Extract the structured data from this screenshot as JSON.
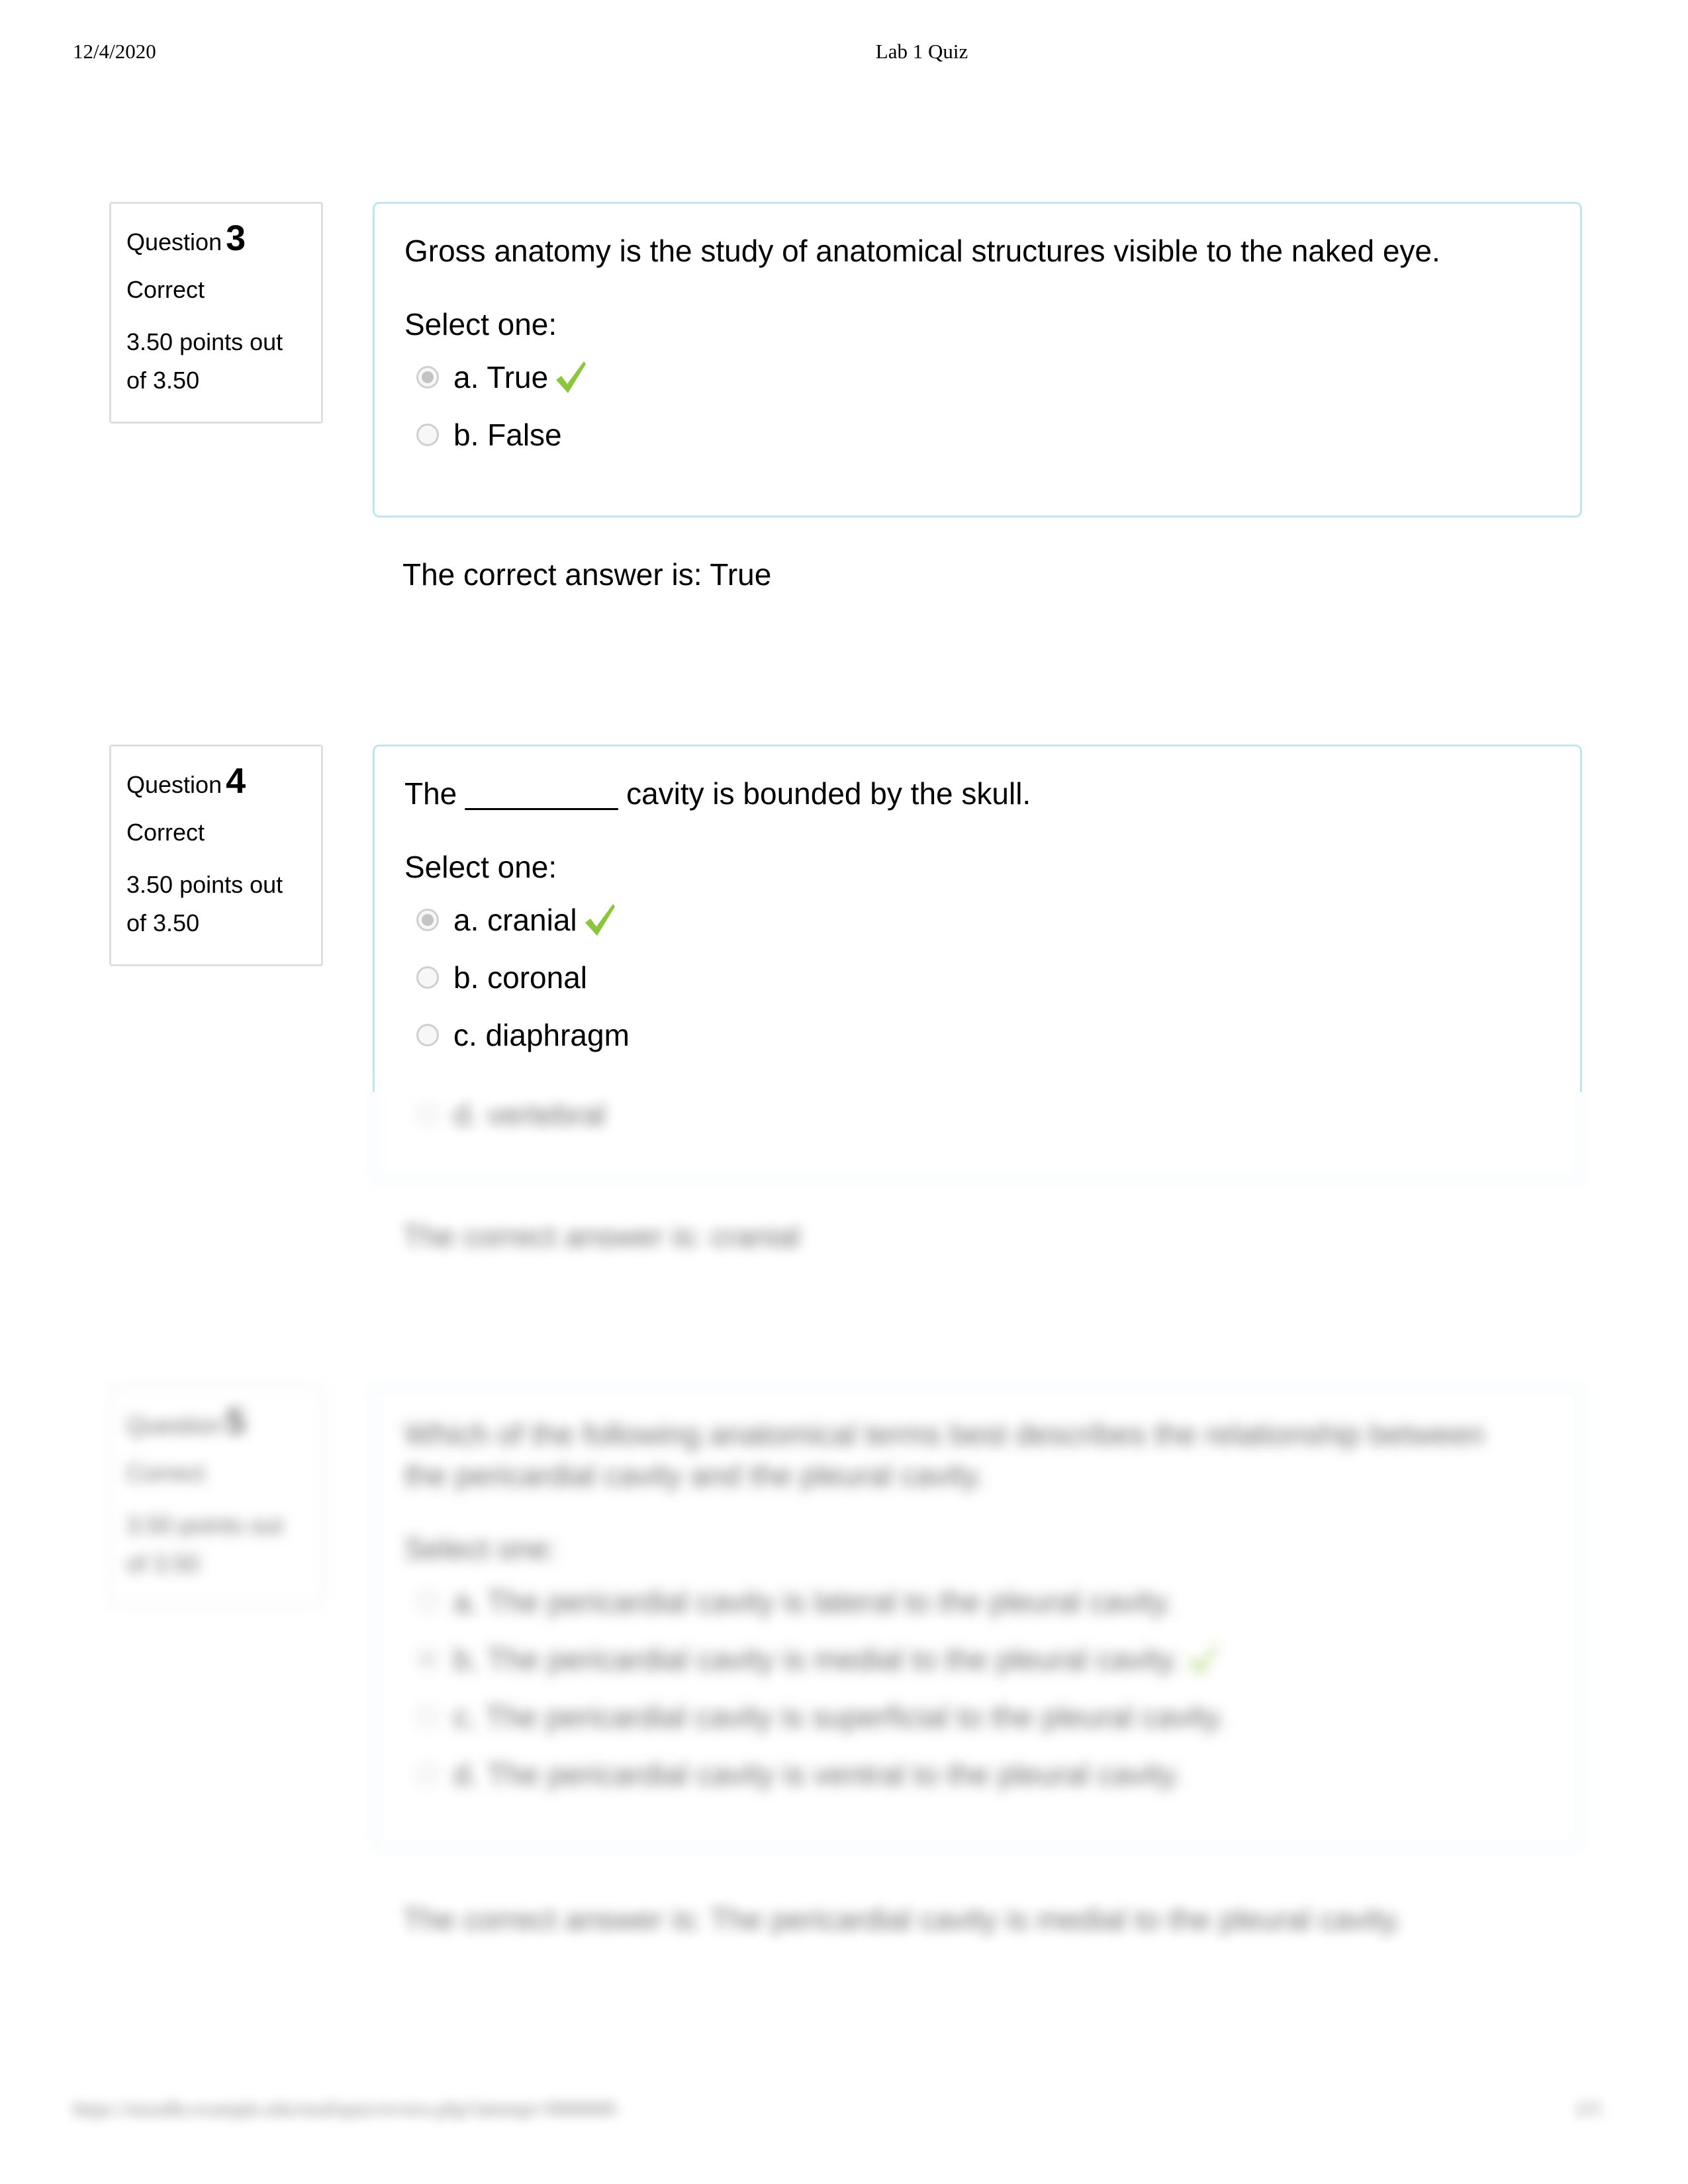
{
  "header": {
    "date": "12/4/2020",
    "title": "Lab 1 Quiz"
  },
  "colors": {
    "correct_check": "#8cc63f",
    "content_border": "#c3e6ec",
    "info_border": "#dedede"
  },
  "questions": [
    {
      "label": "Question",
      "number": "3",
      "state": "Correct",
      "grade": "3.50 points out of 3.50",
      "text": "Gross anatomy is the study of anatomical structures visible to the naked eye.",
      "prompt": "Select one:",
      "answers": [
        {
          "label": "a. True",
          "selected": true,
          "correct": true
        },
        {
          "label": "b. False",
          "selected": false,
          "correct": false
        }
      ],
      "feedback": "The correct answer is: True"
    },
    {
      "label": "Question",
      "number": "4",
      "state": "Correct",
      "grade": "3.50 points out of 3.50",
      "text": "The _________ cavity is bounded by the skull.",
      "prompt": "Select one:",
      "answers": [
        {
          "label": "a. cranial",
          "selected": true,
          "correct": true
        },
        {
          "label": "b. coronal",
          "selected": false,
          "correct": false
        },
        {
          "label": "c. diaphragm",
          "selected": false,
          "correct": false
        },
        {
          "label": "d. vertebral",
          "selected": false,
          "correct": false
        }
      ],
      "feedback": "The correct answer is: cranial"
    },
    {
      "label": "Question",
      "number": "5",
      "state": "Correct",
      "grade": "3.50 points out of 3.50",
      "text": "Which of the following anatomical terms best describes the relationship between the pericardial cavity and the pleural cavity.",
      "prompt": "Select one:",
      "answers": [
        {
          "label": "a. The pericardial cavity is lateral to the pleural cavity.",
          "selected": false,
          "correct": false
        },
        {
          "label": "b. The pericardial cavity is medial to the pleural cavity.",
          "selected": true,
          "correct": true
        },
        {
          "label": "c. The pericardial cavity is superficial to the pleural cavity.",
          "selected": false,
          "correct": false
        },
        {
          "label": "d. The pericardial cavity is ventral to the pleural cavity.",
          "selected": false,
          "correct": false
        }
      ],
      "feedback": "The correct answer is: The pericardial cavity is medial to the pleural cavity."
    }
  ],
  "footer": {
    "url": "https://moodle.example.edu/mod/quiz/review.php?attempt=0000000",
    "page": "2/5"
  }
}
